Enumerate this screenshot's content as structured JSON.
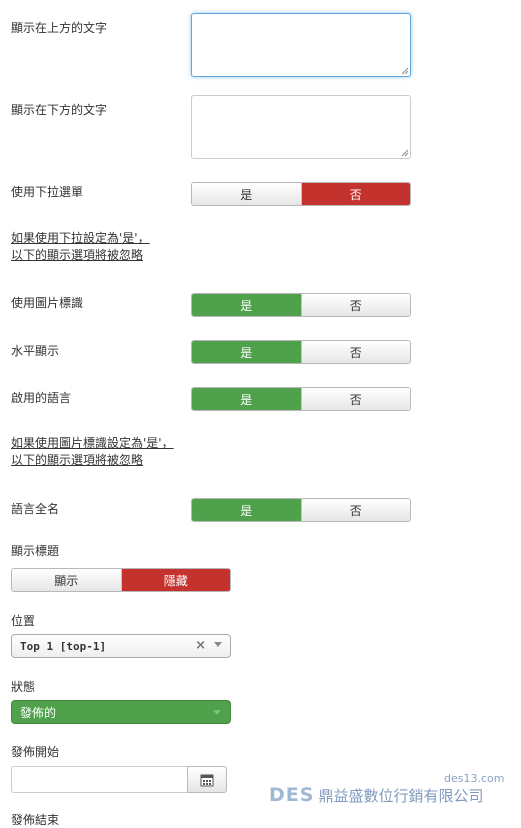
{
  "fields": {
    "text_above_label": "顯示在上方的文字",
    "text_below_label": "顯示在下方的文字",
    "dropdown_label": "使用下拉選單",
    "dropdown_note_line1": "如果使用下拉設定為'是'，",
    "dropdown_note_line2": "以下的顯示選項將被忽略",
    "image_flag_label": "使用圖片標識",
    "horizontal_label": "水平顯示",
    "active_lang_label": "啟用的語言",
    "image_note_line1": "如果使用圖片標識設定為'是'，",
    "image_note_line2": "以下的顯示選項將被忽略",
    "fullname_label": "語言全名",
    "show_title_label": "顯示標題",
    "position_label": "位置",
    "status_label": "狀態",
    "publish_start_label": "發佈開始",
    "publish_end_label": "發佈結束"
  },
  "toggles": {
    "yes": "是",
    "no": "否",
    "show": "顯示",
    "hide": "隱藏"
  },
  "position_select": {
    "value": "Top 1 [top-1]",
    "clear": "×"
  },
  "status_select": {
    "value": "發佈的"
  },
  "watermark": {
    "url": "des13.com",
    "brand": "DES",
    "company": "鼎益盛數位行銷有限公司"
  },
  "colors": {
    "active_green": "#4fa14c",
    "active_red": "#c4322d",
    "focus_blue": "#5ea6e0"
  },
  "icons": {
    "calendar": "calendar-icon",
    "resize": "resize-grip-icon",
    "dropdown": "chevron-down-icon",
    "clear": "clear-icon"
  }
}
